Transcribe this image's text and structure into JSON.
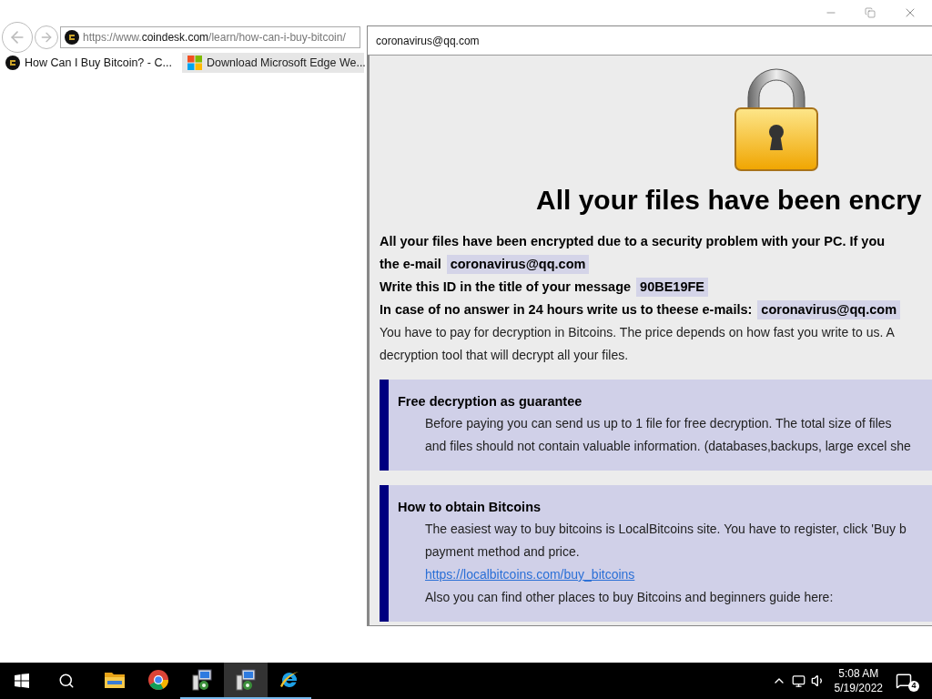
{
  "browser": {
    "address": {
      "url_prefix": "https://www.",
      "url_domain": "coindesk.com",
      "url_path": "/learn/how-can-i-buy-bitcoin/"
    },
    "tabs": [
      {
        "title": "How Can I Buy Bitcoin? - C...",
        "selected": true,
        "kind": "coindesk"
      },
      {
        "title": "Download Microsoft Edge We...",
        "selected": false,
        "kind": "windows"
      }
    ]
  },
  "note_window": {
    "title": "coronavirus@qq.com",
    "heading": "All your files have been encry",
    "lines": [
      {
        "kind": "bold",
        "text": "All your files have been encrypted due to a security problem with your PC. If you"
      },
      {
        "kind": "bold",
        "text": "the e-mail",
        "highlight": "coronavirus@qq.com"
      },
      {
        "kind": "bold",
        "text": "Write this ID in the title of your message",
        "highlight": "90BE19FE"
      },
      {
        "kind": "bold",
        "text": "In case of no answer in 24 hours write us to theese e-mails:",
        "highlight": "coronavirus@qq.com"
      },
      {
        "kind": "normal",
        "text": "You have to pay for decryption in Bitcoins. The price depends on how fast you write to us. A"
      },
      {
        "kind": "normal",
        "text": "decryption tool that will decrypt all your files."
      }
    ],
    "sections": [
      {
        "title": "Free decryption as guarantee",
        "paragraphs": [
          {
            "kind": "text",
            "text": "Before paying you can send us up to 1 file for free decryption. The total size of files"
          },
          {
            "kind": "text",
            "text": "and files should not contain valuable information. (databases,backups, large excel she"
          }
        ]
      },
      {
        "title": "How to obtain Bitcoins",
        "paragraphs": [
          {
            "kind": "text",
            "text": "The easiest way to buy bitcoins is LocalBitcoins site. You have to register, click 'Buy b"
          },
          {
            "kind": "text",
            "text": "payment method and price."
          },
          {
            "kind": "link",
            "text": "https://localbitcoins.com/buy_bitcoins"
          },
          {
            "kind": "text",
            "text": "Also you can find other places to buy Bitcoins and beginners guide here:"
          }
        ]
      }
    ]
  },
  "taskbar": {
    "apps": [
      {
        "kind": "folder",
        "running": false,
        "selected": false
      },
      {
        "kind": "chrome",
        "running": false,
        "selected": false
      },
      {
        "kind": "installer",
        "running": true,
        "selected": false
      },
      {
        "kind": "installer",
        "running": true,
        "selected": true
      },
      {
        "kind": "ie",
        "running": true,
        "selected": false
      }
    ],
    "time": "5:08 AM",
    "date": "5/19/2022",
    "notifications": "4"
  }
}
